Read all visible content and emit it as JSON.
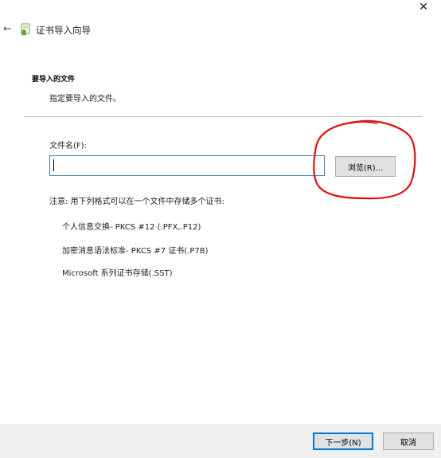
{
  "window": {
    "close_glyph": "✕",
    "back_glyph": "←",
    "title": "证书导入向导"
  },
  "section": {
    "heading": "要导入的文件",
    "subtitle": "指定要导入的文件。"
  },
  "file_input": {
    "label": "文件名(F):",
    "value": ""
  },
  "browse_button": {
    "label": "浏览(R)..."
  },
  "note": "注意: 用下列格式可以在一个文件中存储多个证书:",
  "formats": [
    "个人信息交换- PKCS #12 (.PFX,.P12)",
    "加密消息语法标准- PKCS #7 证书(.P7B)",
    "Microsoft 系列证书存储(.SST)"
  ],
  "footer": {
    "next_label": "下一步(N)",
    "cancel_label": "取消"
  },
  "colors": {
    "annotation": "#e01010",
    "input_border": "#3c7fb1",
    "default_button_border": "#0078d7"
  },
  "icons": {
    "back": "back-arrow-icon",
    "wizard": "certificate-wizard-icon",
    "close": "close-icon"
  }
}
